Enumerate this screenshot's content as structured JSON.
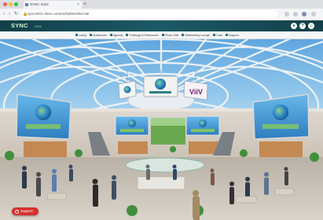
{
  "browser": {
    "tab_title": "SYNC 2022",
    "url": "sync2022.vfairs.com/en/hall/exhibit-hall"
  },
  "site": {
    "logo": "SYNC",
    "logo_sub": "2022",
    "nav_items": [
      "Lobby",
      "Auditorium",
      "Agenda",
      "Trainings & Resources",
      "Photo Wall",
      "Networking Lounge",
      "Chat",
      "Support"
    ]
  },
  "screens": {
    "top_right_banner": "ViiV"
  },
  "chat_button": {
    "label": "Support"
  },
  "colors": {
    "header_teal": "#1b5965",
    "nav_accent": "#1f6f7e",
    "chat_red": "#d7312c",
    "sky_blue": "#8fc6ea"
  }
}
